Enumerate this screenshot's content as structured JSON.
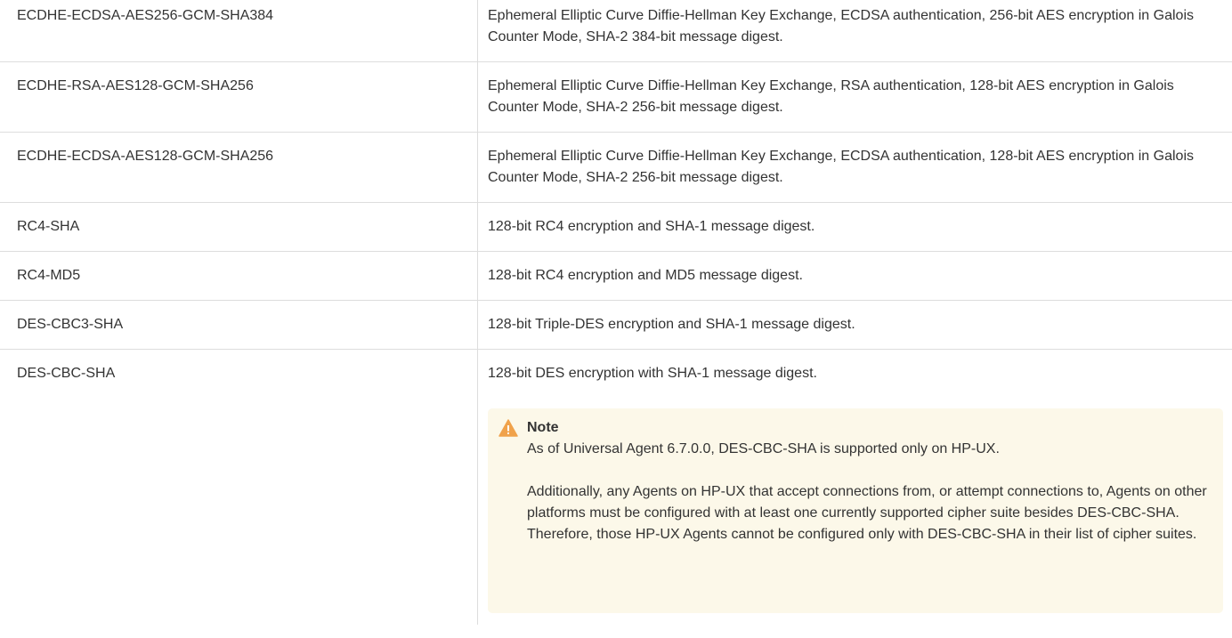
{
  "ciphers": [
    {
      "name": "ECDHE-ECDSA-AES256-GCM-SHA384",
      "description": "Ephemeral Elliptic Curve Diffie-Hellman Key Exchange, ECDSA authentication, 256-bit AES encryption in Galois Counter Mode, SHA-2 384-bit message digest."
    },
    {
      "name": "ECDHE-RSA-AES128-GCM-SHA256",
      "description": "Ephemeral Elliptic Curve Diffie-Hellman Key Exchange, RSA authentication, 128-bit AES encryption in Galois Counter Mode, SHA-2 256-bit message digest."
    },
    {
      "name": "ECDHE-ECDSA-AES128-GCM-SHA256",
      "description": "Ephemeral Elliptic Curve Diffie-Hellman Key Exchange, ECDSA authentication, 128-bit AES encryption in Galois Counter Mode, SHA-2 256-bit message digest."
    },
    {
      "name": "RC4-SHA",
      "description": "128-bit RC4 encryption and SHA-1 message digest."
    },
    {
      "name": "RC4-MD5",
      "description": "128-bit RC4 encryption and MD5 message digest."
    },
    {
      "name": "DES-CBC3-SHA",
      "description": "128-bit Triple-DES encryption and SHA-1 message digest."
    },
    {
      "name": "DES-CBC-SHA",
      "description": "128-bit DES encryption with SHA-1 message digest."
    }
  ],
  "note": {
    "icon": "warning-icon",
    "icon_color": "#f0a24b",
    "background_color": "#fcf8e9",
    "title": "Note",
    "paragraphs": [
      "As of Universal Agent 6.7.0.0, DES-CBC-SHA is supported only on HP-UX.",
      "Additionally, any Agents on HP-UX that accept connections from, or attempt connections to, Agents on other platforms must be configured with at least one currently supported cipher suite besides DES-CBC-SHA. Therefore, those HP-UX Agents cannot be configured only with DES-CBC-SHA in their list of cipher suites."
    ]
  },
  "colors": {
    "text": "#333333",
    "border": "#dddddd"
  }
}
